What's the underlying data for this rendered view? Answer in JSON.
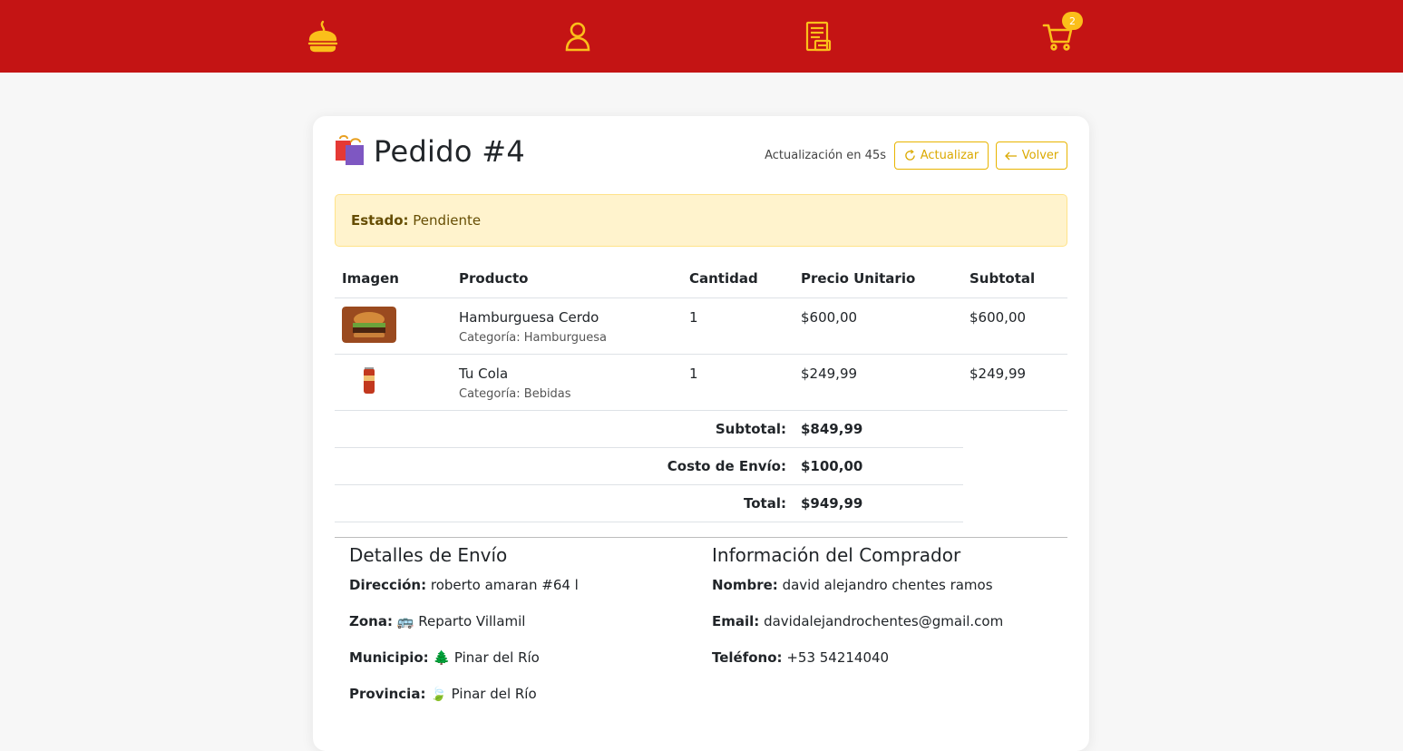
{
  "nav": {
    "cart_count": "2",
    "accent_color": "#fbbf1a",
    "bar_color": "#c41414",
    "icons": [
      "burger-flame-icon",
      "user-icon",
      "receipt-icon",
      "cart-icon"
    ]
  },
  "order": {
    "title": "Pedido #4",
    "refresh_countdown": "Actualización en 45s",
    "refresh_label": "Actualizar",
    "back_label": "Volver",
    "status_label": "Estado:",
    "status_value": "Pendiente"
  },
  "table": {
    "headers": [
      "Imagen",
      "Producto",
      "Cantidad",
      "Precio Unitario",
      "Subtotal"
    ],
    "rows": [
      {
        "name": "Hamburguesa Cerdo",
        "category": "Categoría: Hamburguesa",
        "qty": "1",
        "unit_price": "$600,00",
        "subtotal": "$600,00"
      },
      {
        "name": "Tu Cola",
        "category": "Categoría: Bebidas",
        "qty": "1",
        "unit_price": "$249,99",
        "subtotal": "$249,99"
      }
    ],
    "summary": [
      {
        "label": "Subtotal:",
        "value": "$849,99"
      },
      {
        "label": "Costo de Envío:",
        "value": "$100,00"
      },
      {
        "label": "Total:",
        "value": "$949,99"
      }
    ]
  },
  "shipping": {
    "title": "Detalles de Envío",
    "address_label": "Dirección:",
    "address": "roberto amaran #64 l",
    "zone_label": "Zona:",
    "zone": "🚌 Reparto Villamil",
    "municipality_label": "Municipio:",
    "municipality": "🌲 Pinar del Río",
    "province_label": "Provincia:",
    "province": "🍃 Pinar del Río"
  },
  "buyer": {
    "title": "Información del Comprador",
    "name_label": "Nombre:",
    "name": "david alejandro chentes ramos",
    "email_label": "Email:",
    "email": "davidalejandrochentes@gmail.com",
    "phone_label": "Teléfono:",
    "phone": "+53 54214040"
  }
}
